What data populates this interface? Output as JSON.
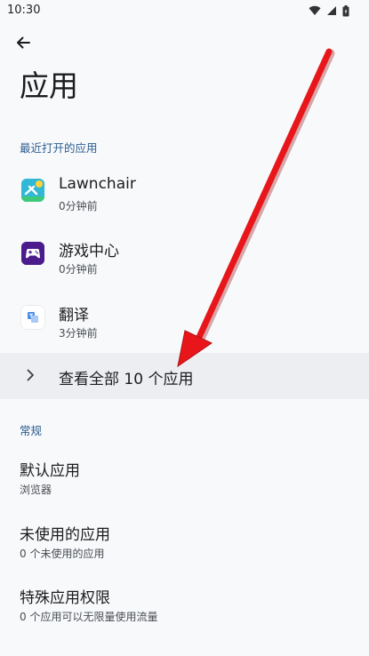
{
  "status_bar": {
    "time": "10:30"
  },
  "header": {
    "title": "应用"
  },
  "recent": {
    "section_label": "最近打开的应用",
    "apps": [
      {
        "name": "Lawnchair",
        "subtitle": "0分钟前",
        "icon": "lawnchair-icon"
      },
      {
        "name": "游戏中心",
        "subtitle": "0分钟前",
        "icon": "game-center-icon"
      },
      {
        "name": "翻译",
        "subtitle": "3分钟前",
        "icon": "translate-icon"
      }
    ],
    "see_all_label": "查看全部 10 个应用"
  },
  "general": {
    "section_label": "常规",
    "items": [
      {
        "title": "默认应用",
        "subtitle": "浏览器"
      },
      {
        "title": "未使用的应用",
        "subtitle": "0 个未使用的应用"
      },
      {
        "title": "特殊应用权限",
        "subtitle": "0 个应用可以无限量使用流量"
      }
    ]
  },
  "colors": {
    "background": "#f7f9fb",
    "section_label": "#2e5d8f",
    "highlight_row": "#eceef1",
    "annotation_arrow": "#e8161a"
  }
}
